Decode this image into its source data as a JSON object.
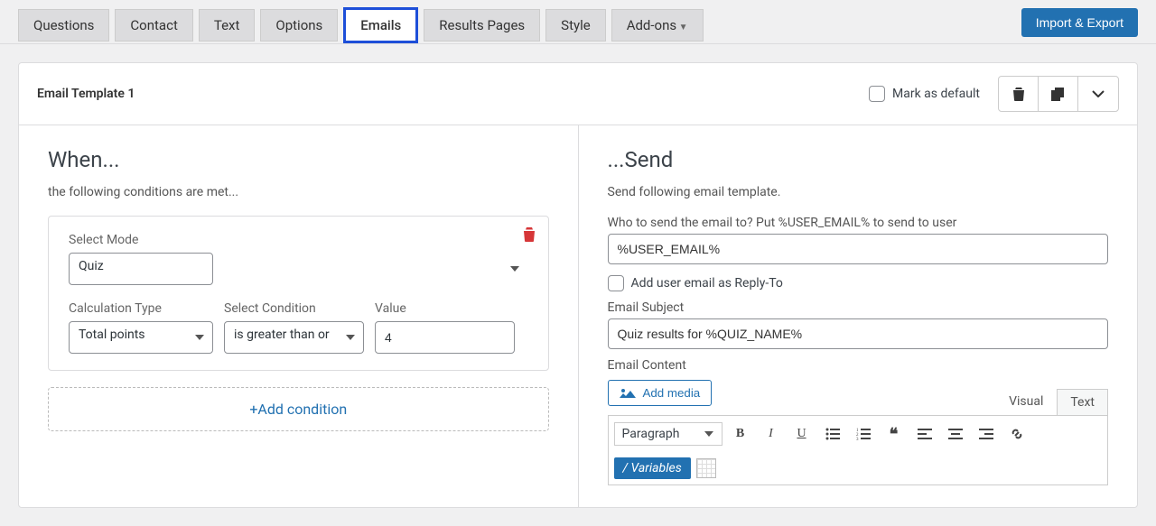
{
  "tabs": {
    "questions": "Questions",
    "contact": "Contact",
    "text": "Text",
    "options": "Options",
    "emails": "Emails",
    "results": "Results Pages",
    "style": "Style",
    "addons": "Add-ons"
  },
  "import_export": "Import & Export",
  "template": {
    "title": "Email Template 1",
    "mark_default": "Mark as default"
  },
  "when": {
    "heading": "When...",
    "sub": "the following conditions are met...",
    "select_mode_label": "Select Mode",
    "select_mode_value": "Quiz",
    "calc_type_label": "Calculation Type",
    "calc_type_value": "Total points",
    "condition_label": "Select Condition",
    "condition_value": "is greater than or",
    "value_label": "Value",
    "value_value": "4",
    "add_condition": "+Add condition"
  },
  "send": {
    "heading": "...Send",
    "sub": "Send following email template.",
    "to_help": "Who to send the email to? Put %USER_EMAIL% to send to user",
    "to_value": "%USER_EMAIL%",
    "reply_to_label": "Add user email as Reply-To",
    "subject_label": "Email Subject",
    "subject_value": "Quiz results for %QUIZ_NAME%",
    "content_label": "Email Content",
    "add_media": "Add media",
    "visual_tab": "Visual",
    "text_tab": "Text",
    "paragraph": "Paragraph",
    "variables": "/ Variables"
  }
}
